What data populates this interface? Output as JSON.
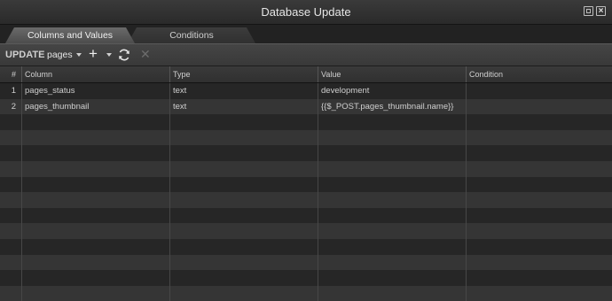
{
  "window": {
    "title": "Database Update"
  },
  "tabs": [
    {
      "label": "Columns and Values",
      "active": true
    },
    {
      "label": "Conditions",
      "active": false
    }
  ],
  "toolbar": {
    "mode_label": "UPDATE",
    "table_selected": "pages",
    "add_icon": "plus-icon",
    "refresh_icon": "refresh-icon",
    "delete_icon": "close-icon"
  },
  "grid": {
    "columns": [
      "#",
      "Column",
      "Type",
      "Value",
      "Condition"
    ],
    "rows": [
      {
        "num": "1",
        "column": "pages_status",
        "type": "text",
        "value": "development",
        "condition": ""
      },
      {
        "num": "2",
        "column": "pages_thumbnail",
        "type": "text",
        "value": "{{$_POST.pages_thumbnail.name}}",
        "condition": ""
      },
      {
        "num": "",
        "column": "",
        "type": "",
        "value": "",
        "condition": ""
      },
      {
        "num": "",
        "column": "",
        "type": "",
        "value": "",
        "condition": ""
      },
      {
        "num": "",
        "column": "",
        "type": "",
        "value": "",
        "condition": ""
      },
      {
        "num": "",
        "column": "",
        "type": "",
        "value": "",
        "condition": ""
      },
      {
        "num": "",
        "column": "",
        "type": "",
        "value": "",
        "condition": ""
      },
      {
        "num": "",
        "column": "",
        "type": "",
        "value": "",
        "condition": ""
      },
      {
        "num": "",
        "column": "",
        "type": "",
        "value": "",
        "condition": ""
      },
      {
        "num": "",
        "column": "",
        "type": "",
        "value": "",
        "condition": ""
      },
      {
        "num": "",
        "column": "",
        "type": "",
        "value": "",
        "condition": ""
      },
      {
        "num": "",
        "column": "",
        "type": "",
        "value": "",
        "condition": ""
      },
      {
        "num": "",
        "column": "",
        "type": "",
        "value": "",
        "condition": ""
      },
      {
        "num": "",
        "column": "",
        "type": "",
        "value": "",
        "condition": ""
      }
    ]
  }
}
